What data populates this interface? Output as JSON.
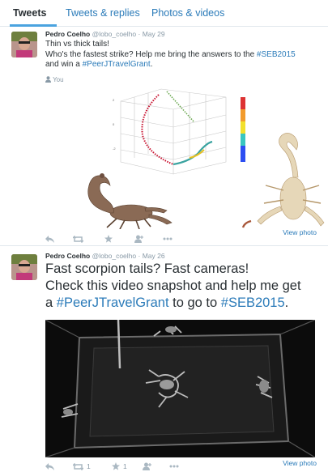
{
  "tabs": [
    {
      "label": "Tweets"
    },
    {
      "label": "Tweets & replies"
    },
    {
      "label": "Photos & videos"
    }
  ],
  "tweets": [
    {
      "author": "Pedro Coelho",
      "handle": "@lobo_coelho",
      "separator": "·",
      "date": "May 29",
      "line1": "Thin vs thick tails!",
      "line2_a": "Who's the fastest strike? Help me bring the answers to the ",
      "line2_tag": "#SEB2015",
      "line3_a": "and win a ",
      "line3_tag": "#PeerJTravelGrant",
      "line3_b": ".",
      "you_label": "You",
      "view_photo": "View photo",
      "retweets": "",
      "favorites": ""
    },
    {
      "author": "Pedro Coelho",
      "handle": "@lobo_coelho",
      "separator": "·",
      "date": "May 26",
      "line1": "Fast scorpion tails? Fast cameras!",
      "line2": "Check this video snapshot and help me get",
      "line3_a": "a ",
      "line3_tag1": "#PeerJTravelGrant",
      "line3_b": " to go to ",
      "line3_tag2": "#SEB2015",
      "line3_c": ".",
      "view_photo": "View photo",
      "retweets": "1",
      "favorites": "1"
    }
  ],
  "icons": {
    "reply": "reply-icon",
    "retweet": "retweet-icon",
    "favorite": "star-icon",
    "follow": "follow-icon",
    "more": "more-icon",
    "you": "person-icon"
  },
  "colors": {
    "link": "#2b7bb9",
    "tab_underline": "#4aa3df",
    "muted": "#8899a6",
    "icon": "#aab8c2"
  }
}
